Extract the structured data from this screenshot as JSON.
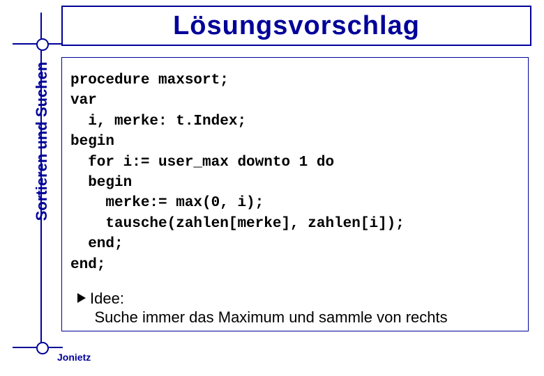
{
  "title": "Lösungsvorschlag",
  "sidebar": "Sortieren und Suchen",
  "code": "procedure maxsort;\nvar\n  i, merke: t.Index;\nbegin\n  for i:= user_max downto 1 do\n  begin\n    merke:= max(0, i);\n    tausche(zahlen[merke], zahlen[i]);\n  end;\nend;",
  "idea": {
    "label": "Idee:",
    "text": "Suche immer das Maximum und sammle von rechts"
  },
  "footer": "Jonietz"
}
